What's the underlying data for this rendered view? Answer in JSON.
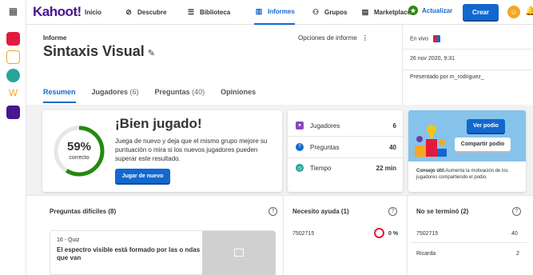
{
  "topbar": {
    "logo": "Kahoot!",
    "nav": [
      {
        "label": "Inicio",
        "icon": "home-icon"
      },
      {
        "label": "Descubre",
        "icon": "compass-icon"
      },
      {
        "label": "Biblioteca",
        "icon": "list-icon"
      },
      {
        "label": "Informes",
        "icon": "chart-icon"
      },
      {
        "label": "Grupos",
        "icon": "people-icon"
      },
      {
        "label": "Marketplace",
        "icon": "store-icon"
      }
    ],
    "upgrade_label": "Actualizar",
    "create_label": "Crear",
    "accent": "#1368ce"
  },
  "header": {
    "label": "Informe",
    "title": "Sintaxis Visual",
    "options_label": "Opciones de informe",
    "tabs": [
      {
        "label": "Resumen",
        "count": ""
      },
      {
        "label": "Jugadores",
        "count": "(6)"
      },
      {
        "label": "Preguntas",
        "count": "(40)"
      },
      {
        "label": "Opiniones",
        "count": ""
      }
    ]
  },
  "info": {
    "mode": "En vivo",
    "date": "26 nov 2020, 9:31",
    "presented_by": "Presentado por m_rodriguez_"
  },
  "score": {
    "percent": "59%",
    "percent_value": 0.59,
    "percent_label": "correcto",
    "heading": "¡Bien jugado!",
    "text": "Juega de nuevo y deja que el mismo grupo mejore su puntuación o mira si los nuevos jugadores pueden superar este resultado.",
    "button": "Jugar de nuevo"
  },
  "stats": {
    "players_label": "Jugadores",
    "players": "6",
    "questions_label": "Preguntas",
    "questions": "40",
    "time_label": "Tiempo",
    "time": "22 min"
  },
  "podium": {
    "view_button": "Ver podio",
    "share_button": "Compartir podio",
    "tip_bold": "Consejo útil:",
    "tip_text": "Aumenta la motivación de los jugadores compartiendo el podio."
  },
  "difficult": {
    "title": "Preguntas difíciles (8)",
    "question_type": "16 - Quiz",
    "question_text": "El espectro visible está formado por las o ndas que van"
  },
  "need_help": {
    "title": "Necesito ayuda (1)",
    "player": "7502715",
    "value": "0 %"
  },
  "not_finished": {
    "title": "No se terminó (2)",
    "rows": [
      {
        "player": "7502715",
        "value": "40"
      },
      {
        "player": "Ricarda",
        "value": "2"
      }
    ]
  }
}
